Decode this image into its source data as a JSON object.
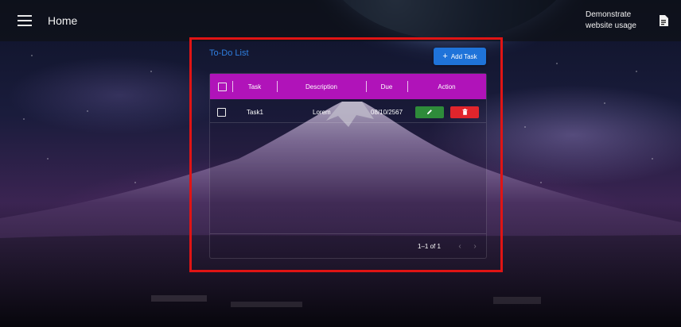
{
  "appbar": {
    "title": "Home",
    "demo_label": "Demonstrate website usage",
    "menu_icon": "hamburger-menu-icon",
    "doc_icon": "document-icon"
  },
  "card": {
    "title": "To-Do List",
    "add_button_label": "Add Task"
  },
  "table": {
    "columns": [
      "Task",
      "Description",
      "Due",
      "Action"
    ],
    "rows": [
      {
        "task": "Task1",
        "description": "Lorem",
        "due": "08/10/2567"
      }
    ],
    "footer": {
      "page_info": "1–1 of 1"
    }
  },
  "colors": {
    "header_bg": "#b013b9",
    "add_button": "#1f73d9",
    "edit_button": "#2e8b3a",
    "delete_button": "#e0252c",
    "highlight": "#e01414",
    "title": "#2f7fe0"
  }
}
